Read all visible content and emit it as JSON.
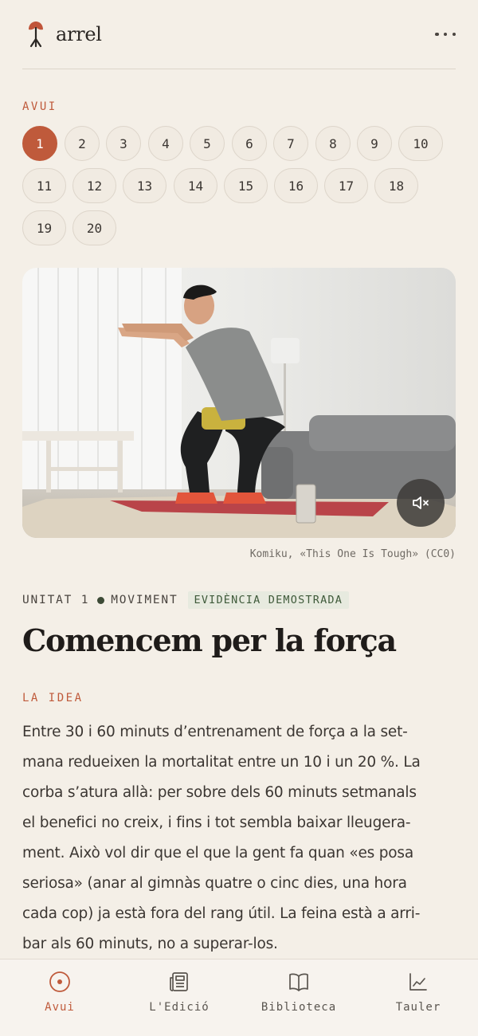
{
  "app": {
    "name": "arrel",
    "logo_icon": "tree-sprout-icon",
    "menu_icon": "more-horizontal-icon"
  },
  "today": {
    "label": "AVUI",
    "active_day": "1",
    "days": [
      "1",
      "2",
      "3",
      "4",
      "5",
      "6",
      "7",
      "8",
      "9",
      "10",
      "11",
      "12",
      "13",
      "14",
      "15",
      "16",
      "17",
      "18",
      "19",
      "20"
    ]
  },
  "video": {
    "mute_icon": "volume-muted-icon",
    "credit": "Komiku, «This One Is Tough» (CC0)"
  },
  "lesson": {
    "unit": "UNITAT 1",
    "category": "MOVIMENT",
    "evidence": "EVIDÈNCIA DEMOSTRADA",
    "title": "Comencem per la força",
    "section_label": "LA IDEA",
    "body_lines": [
      "Entre 30 i 60 minuts d’entrenament de força a la set-",
      "mana redueixen la mortalitat entre un 10 i un 20 %. La",
      "corba s’atura allà: per sobre dels 60 minuts setmanals",
      "el benefici no creix, i fins i tot sembla baixar lleugera-",
      "ment. Això vol dir que el que la gent fa quan «es posa",
      "seriosa» (anar al gimnàs quatre o cinc dies, una hora",
      "cada cop) ja està fora del rang útil. La feina està a arri-",
      "bar als 60 minuts, no a superar-los."
    ]
  },
  "tabs": [
    {
      "label": "Avui",
      "icon": "target-circle-icon",
      "active": true
    },
    {
      "label": "L'Edició",
      "icon": "newspaper-icon",
      "active": false
    },
    {
      "label": "Biblioteca",
      "icon": "open-book-icon",
      "active": false
    },
    {
      "label": "Tauler",
      "icon": "line-chart-icon",
      "active": false
    }
  ],
  "colors": {
    "accent": "#bf5a3b",
    "background": "#f4efe7",
    "evidence_bg": "#e7eadf",
    "evidence_fg": "#3f5a3a"
  }
}
